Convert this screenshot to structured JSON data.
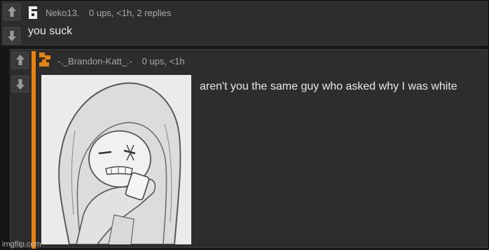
{
  "top_comment": {
    "username": "Neko13.",
    "stats": "0 ups, <1h, 2 replies",
    "text": "you suck"
  },
  "reply_comment": {
    "username": "-._Brandon-Katt_.-",
    "stats": "0 ups, <1h",
    "text": "aren't you the same guy who asked why I was white"
  },
  "watermark": "imgflip.com",
  "icons": {
    "upvote": "arrow-up-icon",
    "downvote": "arrow-down-icon"
  },
  "colors": {
    "background": "#161616",
    "panel": "#2d2d2d",
    "accent": "#e8820f",
    "meta_text": "#a9a9a9",
    "body_text": "#e8e8e8"
  }
}
